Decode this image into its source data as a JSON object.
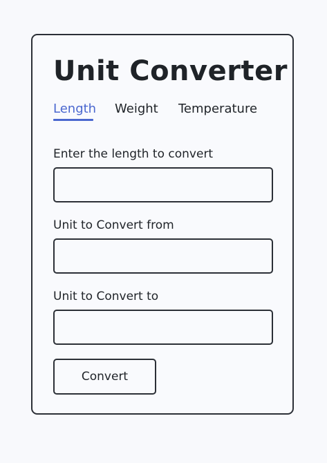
{
  "app": {
    "title": "Unit Converter"
  },
  "tabs": [
    {
      "label": "Length",
      "active": true
    },
    {
      "label": "Weight",
      "active": false
    },
    {
      "label": "Temperature",
      "active": false
    }
  ],
  "form": {
    "value_label": "Enter the length to convert",
    "value_input": {
      "value": "",
      "placeholder": ""
    },
    "from_label": "Unit to Convert from",
    "from_input": {
      "value": "",
      "placeholder": ""
    },
    "to_label": "Unit to Convert to",
    "to_input": {
      "value": "",
      "placeholder": ""
    },
    "convert_label": "Convert"
  },
  "colors": {
    "accent": "#4a67cf",
    "border": "#2b2f36",
    "text": "#1f2328",
    "background": "#f8f9fc"
  }
}
